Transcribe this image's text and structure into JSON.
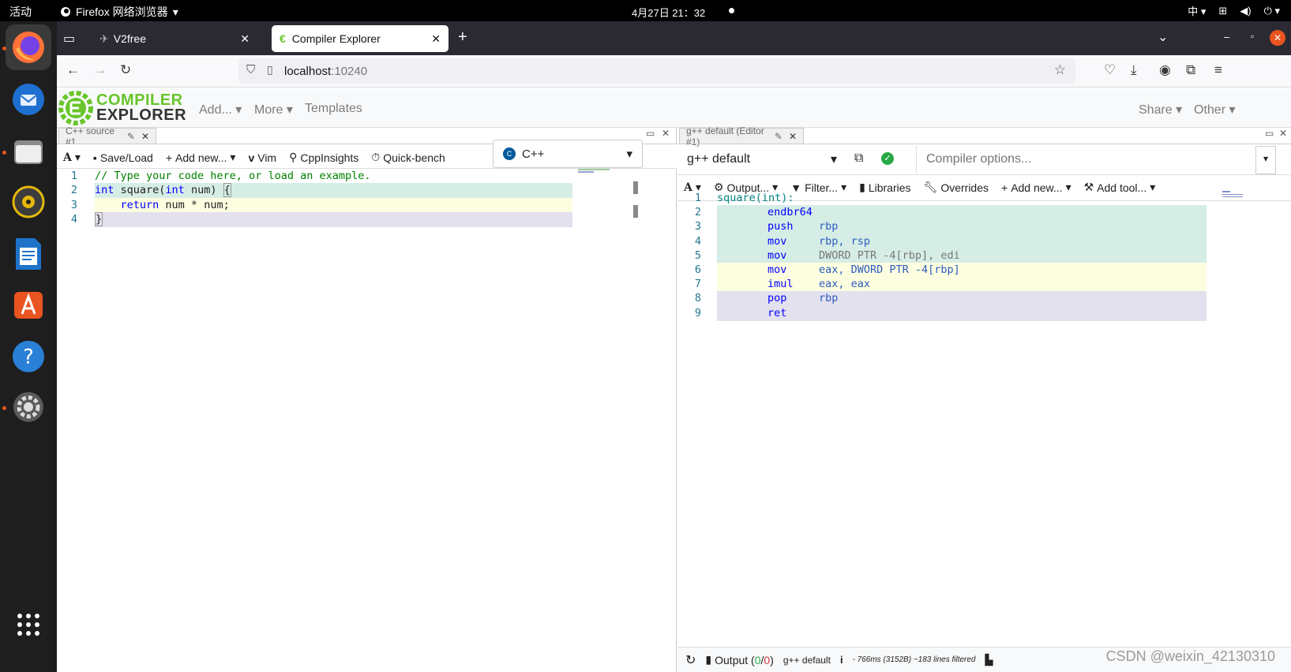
{
  "topbar": {
    "activities": "活动",
    "app_name": "Firefox 网络浏览器",
    "clock": "4月27日 21：32",
    "input_method": "中"
  },
  "browser": {
    "tabs": [
      {
        "label": "V2free"
      },
      {
        "label": "Compiler Explorer"
      }
    ],
    "url_host": "localhost",
    "url_port": ":10240"
  },
  "ce_header": {
    "logo_line1": "COMPILER",
    "logo_line2": "EXPLORER",
    "menu_add": "Add...",
    "menu_more": "More",
    "menu_templates": "Templates",
    "menu_share": "Share",
    "menu_other": "Other"
  },
  "source_pane": {
    "tab_title": "C++ source #1",
    "toolbar": {
      "save_load": "Save/Load",
      "add_new": "Add new...",
      "vim": "Vim",
      "cppinsights": "CppInsights",
      "quickbench": "Quick-bench"
    },
    "language": "C++",
    "lines": [
      {
        "n": "1",
        "text": "// Type your code here, or load an example."
      },
      {
        "n": "2",
        "text": "int square(int num) {"
      },
      {
        "n": "3",
        "text": "    return num * num;"
      },
      {
        "n": "4",
        "text": "}"
      }
    ]
  },
  "compiler_pane": {
    "tab_title": "g++ default (Editor #1)",
    "compiler": "g++ default",
    "options_placeholder": "Compiler options...",
    "toolbar": {
      "output": "Output...",
      "filter": "Filter...",
      "libraries": "Libraries",
      "overrides": "Overrides",
      "add_new": "Add new...",
      "add_tool": "Add tool..."
    },
    "asm": [
      {
        "n": "1",
        "label": "square(int):"
      },
      {
        "n": "2",
        "op": "endbr64",
        "args": ""
      },
      {
        "n": "3",
        "op": "push",
        "args": "rbp"
      },
      {
        "n": "4",
        "op": "mov",
        "args": "rbp, rsp"
      },
      {
        "n": "5",
        "op": "mov",
        "args": "DWORD PTR -4[rbp], edi"
      },
      {
        "n": "6",
        "op": "mov",
        "args": "eax, DWORD PTR -4[rbp]"
      },
      {
        "n": "7",
        "op": "imul",
        "args": "eax, eax"
      },
      {
        "n": "8",
        "op": "pop",
        "args": "rbp"
      },
      {
        "n": "9",
        "op": "ret",
        "args": ""
      }
    ],
    "status": {
      "output_label": "Output (",
      "output_ok": "0",
      "output_sep": "/",
      "output_err": "0",
      "output_close": ")",
      "compiler": "g++ default",
      "info": "- 766ms (3152B) ~183 lines filtered"
    }
  },
  "watermark": "CSDN @weixin_42130310",
  "colors": {
    "ce_green": "#67c52a",
    "firefox_dark": "#2b2a33"
  }
}
